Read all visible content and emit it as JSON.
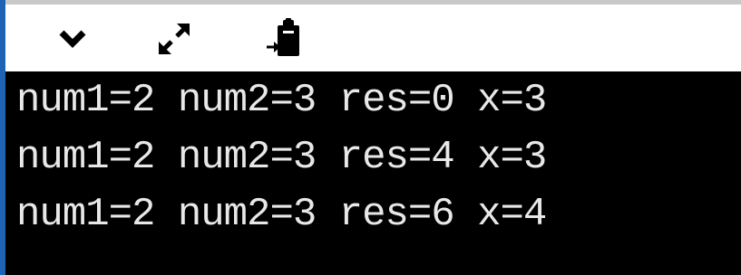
{
  "toolbar": {
    "icons": [
      {
        "name": "chevron-down-icon"
      },
      {
        "name": "expand-icon"
      },
      {
        "name": "clipboard-paste-icon"
      }
    ]
  },
  "console": {
    "lines": [
      "num1=2 num2=3 res=0 x=3",
      "num1=2 num2=3 res=4 x=3",
      "num1=2 num2=3 res=6 x=4"
    ]
  },
  "colors": {
    "console_background": "#000000",
    "console_text": "#e8e8e8",
    "toolbar_background": "#ffffff",
    "window_accent": "#1f63b4"
  }
}
